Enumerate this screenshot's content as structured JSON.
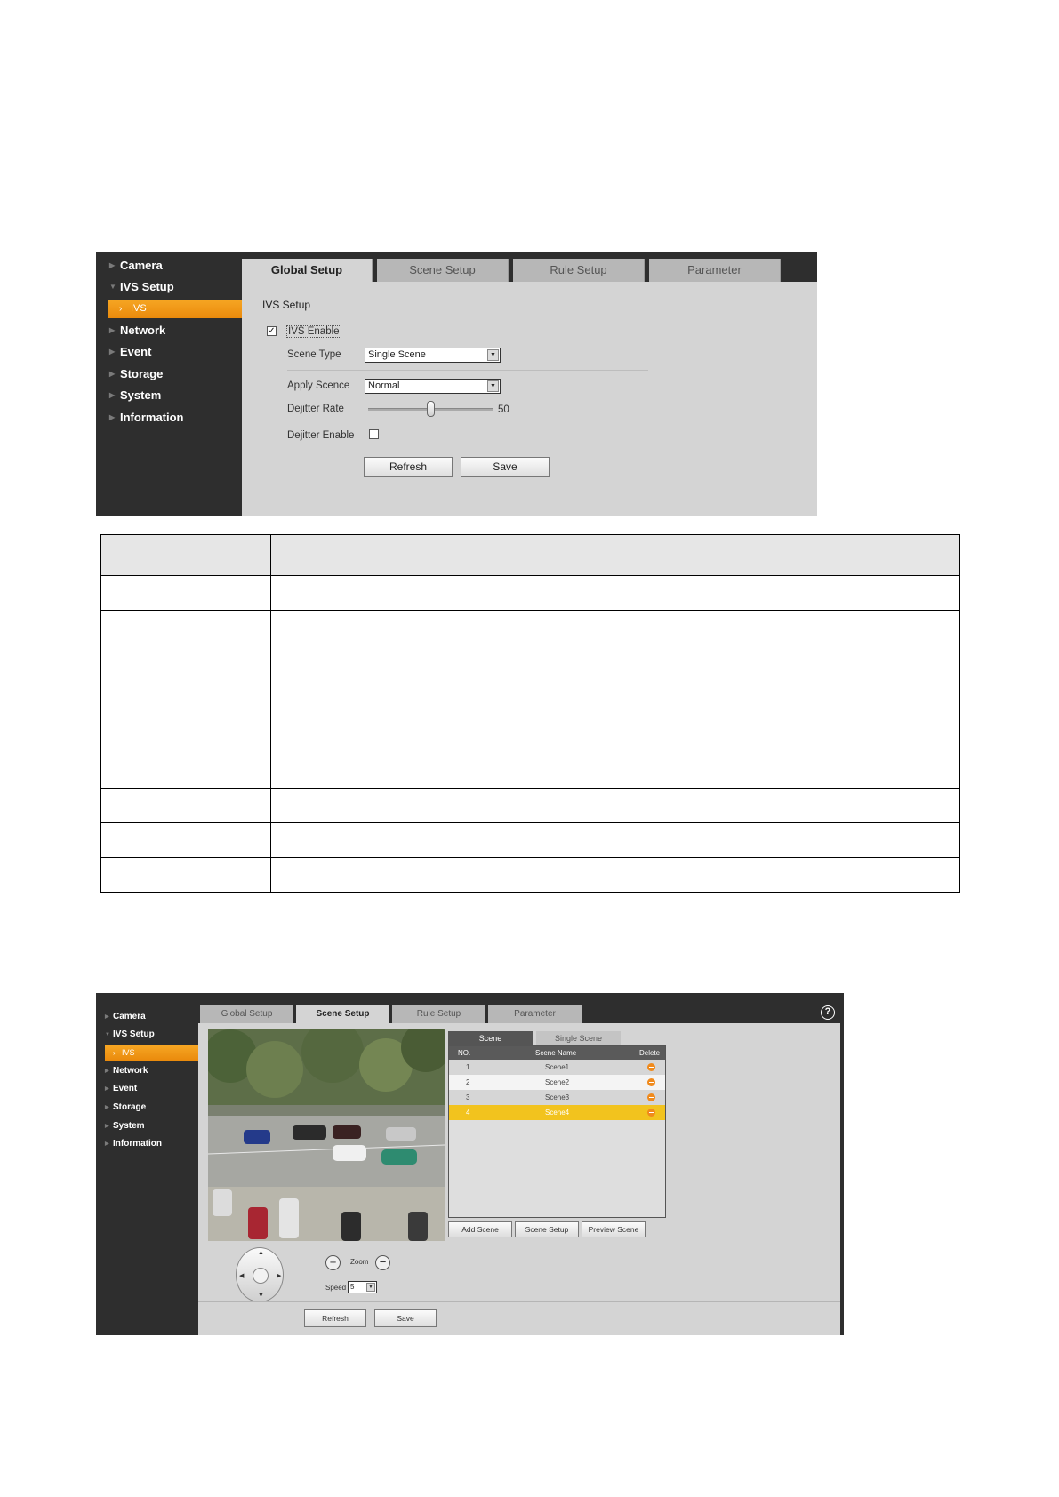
{
  "shot1": {
    "sidebar": {
      "items": [
        "Camera",
        "IVS Setup",
        "Network",
        "Event",
        "Storage",
        "System",
        "Information"
      ],
      "active_sub": "IVS"
    },
    "tabs": [
      "Global Setup",
      "Scene Setup",
      "Rule Setup",
      "Parameter"
    ],
    "active_tab": "Global Setup",
    "section_title": "IVS Setup",
    "ivs_enable": {
      "label": "IVS Enable",
      "checked": true,
      "mark": "✓"
    },
    "scene_type": {
      "label": "Scene Type",
      "value": "Single Scene"
    },
    "apply_scene": {
      "label": "Apply Scence",
      "value": "Normal"
    },
    "dejitter_rate": {
      "label": "Dejitter Rate",
      "value": "50"
    },
    "dejitter_enable": {
      "label": "Dejitter Enable",
      "checked": false
    },
    "buttons": {
      "refresh": "Refresh",
      "save": "Save"
    }
  },
  "shot2": {
    "sidebar": {
      "items": [
        "Camera",
        "IVS Setup",
        "Network",
        "Event",
        "Storage",
        "System",
        "Information"
      ],
      "active_sub": "IVS"
    },
    "tabs": [
      "Global Setup",
      "Scene Setup",
      "Rule Setup",
      "Parameter"
    ],
    "active_tab": "Scene Setup",
    "help_glyph": "?",
    "subtabs": [
      "Scene",
      "Single Scene"
    ],
    "grid": {
      "headers": [
        "NO.",
        "Scene Name",
        "Delete"
      ],
      "rows": [
        {
          "no": "1",
          "name": "Scene1"
        },
        {
          "no": "2",
          "name": "Scene2"
        },
        {
          "no": "3",
          "name": "Scene3"
        },
        {
          "no": "4",
          "name": "Scene4",
          "selected": true
        }
      ]
    },
    "scene_buttons": [
      "Add Scene",
      "Scene Setup",
      "Preview Scene"
    ],
    "zoom": {
      "plus": "+",
      "label": "Zoom",
      "minus": "−"
    },
    "speed": {
      "label": "Speed",
      "value": "5"
    },
    "buttons": {
      "refresh": "Refresh",
      "save": "Save"
    },
    "colors": {
      "orange": "#f39a1c",
      "selected_row": "#f2c31e",
      "sidebar": "#2e2e2e"
    }
  }
}
